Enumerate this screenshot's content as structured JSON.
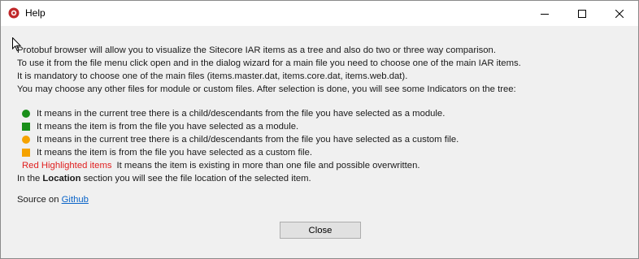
{
  "window": {
    "title": "Help"
  },
  "intro": {
    "lines": [
      "Protobuf browser will allow you to visualize the Sitecore IAR items as a tree and also do two or three way comparison.",
      "To use it from the file menu click open and in the dialog wizard for a main file you need to choose one of the main IAR items.",
      "It is mandatory to choose one of the main files (items.master.dat, items.core.dat, items.web.dat).",
      "You may choose any other files for module or custom files. After selection is done, you will see some Indicators on the tree:"
    ]
  },
  "legend": {
    "items": [
      {
        "symbol": "green-circle-icon",
        "color": "#1a8f1a",
        "text": "It means in the current tree there is a child/descendants from the file you have selected as a module."
      },
      {
        "symbol": "green-square-icon",
        "color": "#1a8f1a",
        "text": "It means the item is from the file you have selected as a module."
      },
      {
        "symbol": "orange-circle-icon",
        "color": "#f5a300",
        "text": "It means in the current tree there is a child/descendants from the file you have selected as a custom file."
      },
      {
        "symbol": "orange-square-icon",
        "color": "#f5a300",
        "text": "It means the item is from the file you have selected as a custom file."
      }
    ],
    "red_highlight": {
      "label": "Red Highlighted items",
      "color": "#e02020",
      "text": "It means the item is existing in more than one file and possible overwritten."
    }
  },
  "location": {
    "prefix": "In the ",
    "bold": "Location",
    "suffix": " section you will see the file location of the selected item."
  },
  "source": {
    "prefix": "Source on ",
    "link_text": "Github"
  },
  "buttons": {
    "close_label": "Close"
  }
}
